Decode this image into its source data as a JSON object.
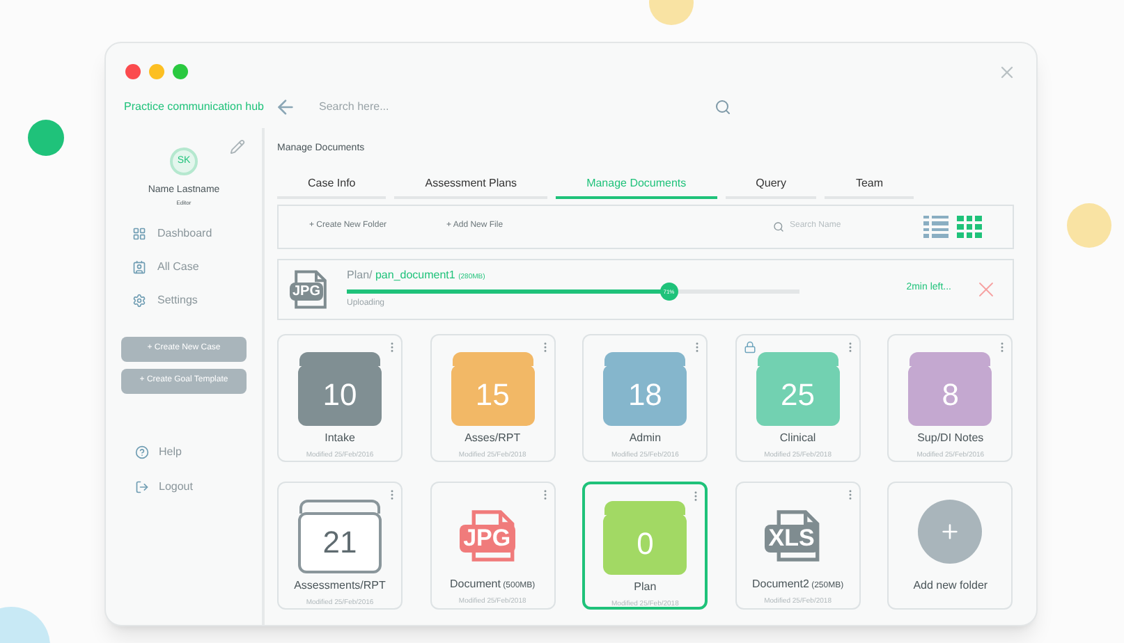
{
  "window": {
    "title": "Practice communication hub"
  },
  "search": {
    "placeholder": "Search here..."
  },
  "profile": {
    "initials": "SK",
    "name": "Name Lastname",
    "role": "Editor"
  },
  "nav": [
    {
      "label": "Dashboard"
    },
    {
      "label": "All Case"
    },
    {
      "label": "Settings"
    }
  ],
  "actions": [
    "+ Create New Case",
    "+ Create Goal Template"
  ],
  "footer_nav": [
    {
      "label": "Help"
    },
    {
      "label": "Logout"
    }
  ],
  "page_title": "Manage Documents",
  "tabs": [
    {
      "label": "Case Info",
      "selected": false
    },
    {
      "label": "Assessment Plans",
      "selected": false
    },
    {
      "label": "Manage Documents",
      "selected": true
    },
    {
      "label": "Query",
      "selected": false
    },
    {
      "label": "Team",
      "selected": false
    }
  ],
  "toolbar": {
    "create_folder": "+ Create New Folder",
    "add_file": "+ Add New File",
    "search_placeholder": "Search Name",
    "views": [
      {
        "kind": "list",
        "selected": false
      },
      {
        "kind": "grid",
        "selected": true
      }
    ]
  },
  "upload": {
    "type": "JPG",
    "folder": "Plan/",
    "file": "pan_document1",
    "size": "(280MB)",
    "status": "Uploading",
    "level": 0.71,
    "percent": "71%",
    "remaining": "2min left..."
  },
  "items": [
    {
      "kind": "folder",
      "count": "10",
      "name": "Intake",
      "modified": "Modified 25/Feb/2016",
      "color": "#808f93",
      "outlined": false,
      "locked": false,
      "selected": false
    },
    {
      "kind": "folder",
      "count": "15",
      "name": "Asses/RPT",
      "modified": "Modified 25/Feb/2018",
      "color": "#f2b866",
      "outlined": false,
      "locked": false,
      "selected": false
    },
    {
      "kind": "folder",
      "count": "18",
      "name": "Admin",
      "modified": "Modified 25/Feb/2016",
      "color": "#85b6cc",
      "outlined": false,
      "locked": false,
      "selected": false
    },
    {
      "kind": "folder",
      "count": "25",
      "name": "Clinical",
      "modified": "Modified 25/Feb/2018",
      "color": "#72d1b1",
      "outlined": false,
      "locked": true,
      "selected": false
    },
    {
      "kind": "folder",
      "count": "8",
      "name": "Sup/DI Notes",
      "modified": "Modified 25/Feb/2016",
      "color": "#c4a8d0",
      "outlined": false,
      "locked": false,
      "selected": false
    },
    {
      "kind": "folder",
      "count": "21",
      "name": "Assessments/RPT",
      "modified": "Modified 25/Feb/2016",
      "color": "#8a969b",
      "outlined": true,
      "locked": false,
      "selected": false
    },
    {
      "kind": "file",
      "type": "JPG",
      "name": "Document",
      "size": "(500MB)",
      "modified": "Modified 25/Feb/2018",
      "color": "#f07b7b",
      "locked": false,
      "selected": false
    },
    {
      "kind": "folder",
      "count": "0",
      "name": "Plan",
      "modified": "Modified 25/Feb/2018",
      "color": "#a2d964",
      "outlined": false,
      "locked": false,
      "selected": true
    },
    {
      "kind": "file",
      "type": "XLS",
      "name": "Document2",
      "size": "(250MB)",
      "modified": "Modified 25/Feb/2018",
      "color": "#7f8c90",
      "locked": false,
      "selected": false
    },
    {
      "kind": "add",
      "name": "Add new folder"
    }
  ]
}
